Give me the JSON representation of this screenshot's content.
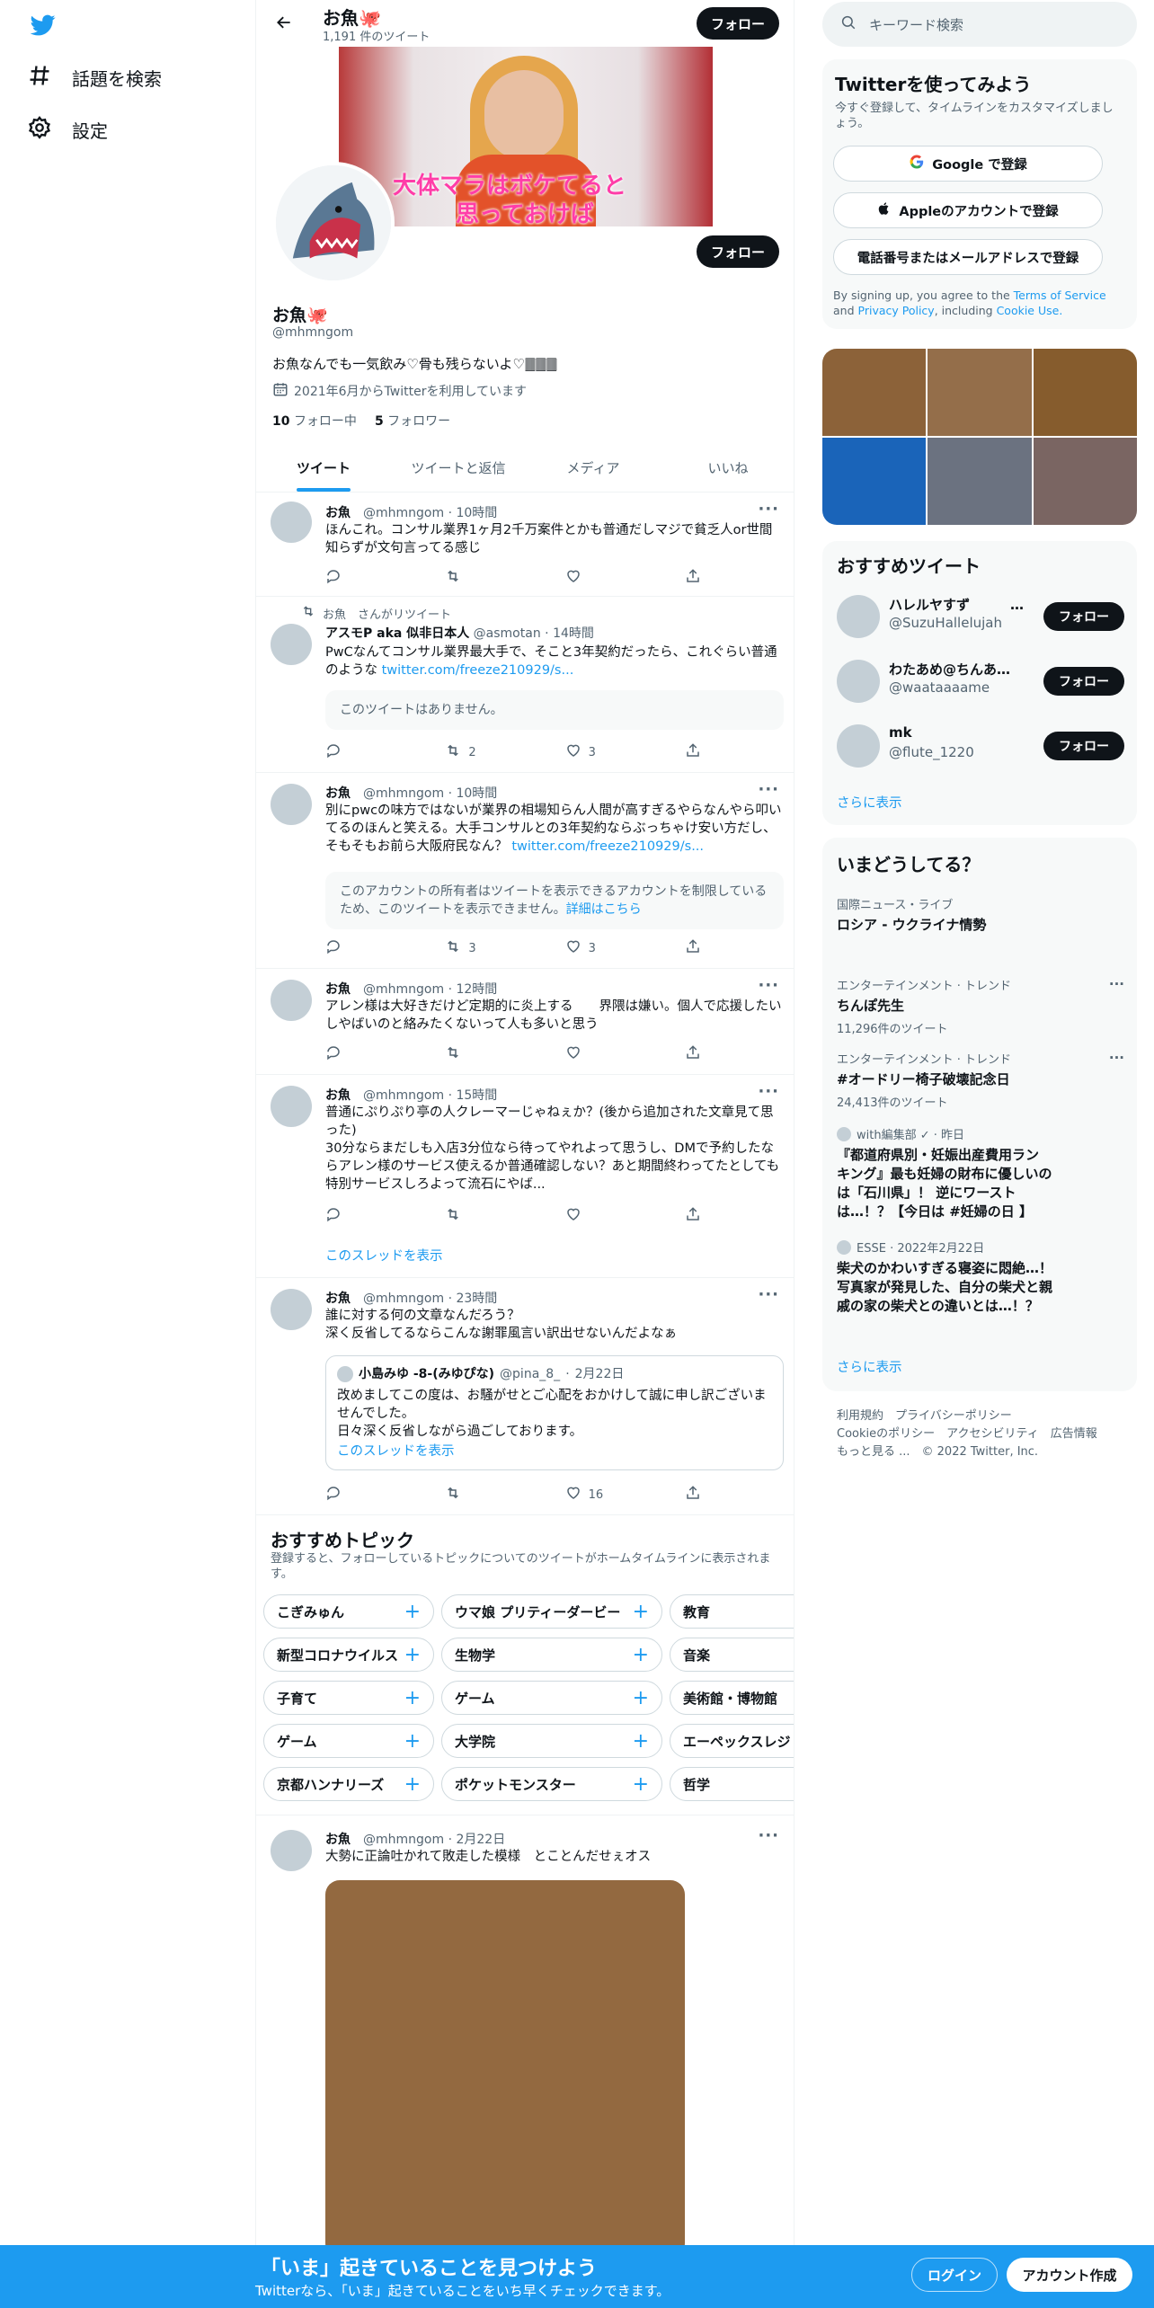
{
  "nav": {
    "items": [
      {
        "label": "話題を検索",
        "icon": "hashtag-icon"
      },
      {
        "label": "設定",
        "icon": "gear-icon"
      }
    ]
  },
  "header": {
    "title": "お魚🐙",
    "subtitle": "1,191 件のツイート",
    "follow_label": "フォロー"
  },
  "banner": {
    "caption_line1": "大体マラはボケてると",
    "caption_line2": "思っておけば"
  },
  "profile": {
    "name": "お魚🐙",
    "handle": "@mhmngom",
    "bio": "お魚なんでも一気飲み♡骨も残らないよ♡🀫🀫🀫",
    "joined": "2021年6月からTwitterを利用しています",
    "following_count": "10",
    "following_label": "フォロー中",
    "followers_count": "5",
    "followers_label": "フォロワー",
    "follow_label": "フォロー"
  },
  "tabs": [
    "ツイート",
    "ツイートと返信",
    "メディア",
    "いいね"
  ],
  "tweets": [
    {
      "name": "お魚",
      "handle": "@mhmngom",
      "time": "10時間",
      "text": "ほんこれ。コンサル業界1ヶ月2千万案件とかも普通だしマジで貧乏人or世間知らずが文句言ってる感じ",
      "reply": "",
      "retweet": "",
      "like": ""
    },
    {
      "retweeted_by": "お魚　さんがリツイート",
      "name": "アスモP aka 似非日本人",
      "handle": "@asmotan",
      "time": "14時間",
      "text": "PwCなんてコンサル業界最大手で、そこと3年契約だったら、これぐらい普通のような",
      "link": "twitter.com/freeze210929/s...",
      "tombstone": "このツイートはありません。",
      "reply": "",
      "retweet": "2",
      "like": "3"
    },
    {
      "name": "お魚",
      "handle": "@mhmngom",
      "time": "10時間",
      "text": "別にpwcの味方ではないが業界の相場知らん人間が高すぎるやらなんやら叩いてるのほんと笑える。大手コンサルとの3年契約ならぶっちゃけ安い方だし、そもそもお前ら大阪府民なん？",
      "link": "twitter.com/freeze210929/s...",
      "tombstone": "このアカウントの所有者はツイートを表示できるアカウントを制限しているため、このツイートを表示できません。",
      "tombstone_link": "詳細はこちら",
      "reply": "",
      "retweet": "3",
      "like": "3"
    },
    {
      "name": "お魚",
      "handle": "@mhmngom",
      "time": "12時間",
      "text": "アレン様は大好きだけど定期的に炎上する　　界隈は嫌い。個人で応援したいしやばいのと絡みたくないって人も多いと思う",
      "reply": "",
      "retweet": "",
      "like": ""
    },
    {
      "name": "お魚",
      "handle": "@mhmngom",
      "time": "15時間",
      "text": "普通にぷりぷり亭の人クレーマーじゃねぇか？(後から追加された文章見て思った)\n30分ならまだしも入店3分位なら待ってやれよって思うし、DMで予約したならアレン様のサービス使えるか普通確認しない？あと期間終わってたとしても特別サービスしろよって流石にやば...",
      "show_thread": "このスレッドを表示",
      "reply": "",
      "retweet": "",
      "like": ""
    },
    {
      "name": "お魚",
      "handle": "@mhmngom",
      "time": "23時間",
      "text": "誰に対する何の文章なんだろう？\n深く反省してるならこんな謝罪風言い訳出せないんだよなぁ",
      "quote": {
        "name": "小島みゆ -8-(みゆぴな)",
        "handle": "@pina_8_",
        "time": "2月22日",
        "text": "改めましてこの度は、お騒がせとご心配をおかけして誠に申し訳ございませんでした。\n日々深く反省しながら過ごしております。",
        "show_thread": "このスレッドを表示"
      },
      "reply": "",
      "retweet": "",
      "like": "16"
    },
    {
      "name": "お魚",
      "handle": "@mhmngom",
      "time": "2月22日",
      "text": "大勢に正論吐かれて敗走した模様　とことんだせぇオス"
    }
  ],
  "topics": {
    "title": "おすすめトピック",
    "subtitle": "登録すると、フォローしているトピックについてのツイートがホームタイムラインに表示されます。",
    "rows": [
      [
        "こぎみゅん",
        "ウマ娘 プリティーダービー",
        "教育"
      ],
      [
        "新型コロナウイルス",
        "生物学",
        "音楽"
      ],
      [
        "子育て",
        "ゲーム",
        "美術館・博物館"
      ],
      [
        "ゲーム",
        "大学院",
        "エーペックスレジ"
      ],
      [
        "京都ハンナリーズ",
        "ポケットモンスター",
        "哲学"
      ]
    ]
  },
  "search": {
    "placeholder": "キーワード検索"
  },
  "signup": {
    "title": "Twitterを使ってみよう",
    "subtitle": "今すぐ登録して、タイムラインをカスタマイズしましょう。",
    "google": "Google で登録",
    "apple": "Appleのアカウントで登録",
    "phone": "電話番号またはメールアドレスで登録",
    "legal_pre": "By signing up, you agree to the",
    "tos": "Terms of Service",
    "and": "and",
    "privacy": "Privacy Policy",
    "including": ", including",
    "cookie": "Cookie Use."
  },
  "media_colors": [
    "#8c6239",
    "#946e4a",
    "#865c2d",
    "#1a64b9",
    "#6b7280",
    "#7a6562"
  ],
  "who_to_follow": {
    "title": "おすすめツイート",
    "users": [
      {
        "name": "ハレルヤすず　　　…",
        "handle": "@SuzuHallelujah",
        "follow": "フォロー"
      },
      {
        "name": "わたあめ@ちんあめ...",
        "handle": "@waataaaame",
        "follow": "フォロー"
      },
      {
        "name": "mk",
        "handle": "@flute_1220",
        "follow": "フォロー"
      }
    ],
    "more": "さらに表示"
  },
  "trends": {
    "title": "いまどうしてる？",
    "items": [
      {
        "context": "国際ニュース・ライブ",
        "title": "ロシア - ウクライナ情勢",
        "count": ""
      },
      {
        "context": "エンターテインメント · トレンド",
        "title": "ちんぽ先生",
        "count": "11,296件のツイート"
      },
      {
        "context": "エンターテインメント · トレンド",
        "title": "#オードリー椅子破壊記念日",
        "count": "24,413件のツイート"
      },
      {
        "context": "with編集部 ✓ · 昨日",
        "title": "『都道府県別・妊娠出産費用ランキング』最も妊婦の財布に優しいのは「石川県」！ 逆にワーストは…！？【今日は #妊婦の日 】",
        "count": ""
      },
      {
        "context": "ESSE · 2022年2月22日",
        "title": "柴犬のかわいすぎる寝姿に悶絶…！写真家が発見した、自分の柴犬と親戚の家の柴犬との違いとは…！？",
        "count": ""
      }
    ],
    "more": "さらに表示"
  },
  "footer": {
    "line1": "利用規約　プライバシーポリシー",
    "line2": "Cookieのポリシー　アクセシビリティ　広告情報",
    "line3": "もっと見る ...　© 2022 Twitter, Inc."
  },
  "bottombar": {
    "title": "「いま」起きていることを見つけよう",
    "subtitle": "Twitterなら、「いま」起きていることをいち早くチェックできます。",
    "login": "ログイン",
    "signup": "アカウント作成"
  },
  "colors": {
    "accent": "#1d9bf0",
    "text": "#0f1419",
    "muted": "#536471"
  }
}
